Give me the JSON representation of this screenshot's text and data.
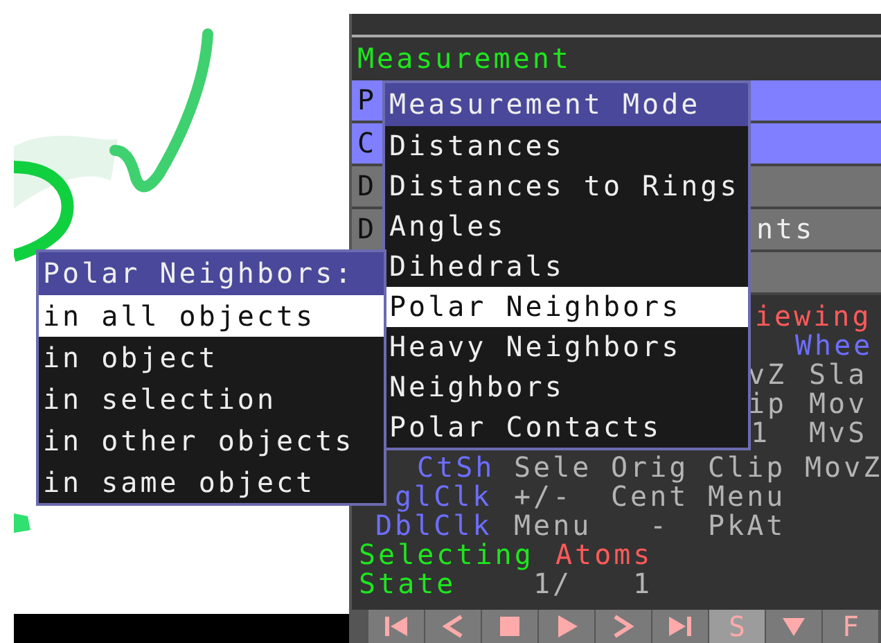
{
  "panel": {
    "title": "Measurement",
    "buttons": [
      {
        "label": "P",
        "color": "#7f7fff"
      },
      {
        "label": "C",
        "color": "#7f7fff"
      },
      {
        "label": "D",
        "color": "#737373"
      },
      {
        "label": "D",
        "tail": "nts",
        "color": "#737373"
      },
      {
        "color": "#737373"
      }
    ],
    "mouse_rows": [
      [
        {
          "text": "iewing",
          "kind": "mode"
        }
      ],
      [
        {
          "text": "Whee",
          "kind": "button"
        }
      ],
      [
        {
          "text": "vZ",
          "kind": "action"
        },
        {
          "text": "Sla",
          "kind": "action"
        }
      ],
      [
        {
          "text": "ip",
          "kind": "action"
        },
        {
          "text": "Mov",
          "kind": "action"
        }
      ],
      [
        {
          "text": "1",
          "kind": "action"
        },
        {
          "text": "MvS",
          "kind": "action"
        }
      ],
      [
        {
          "text": "CtSh",
          "kind": "button"
        },
        {
          "text": "Sele",
          "kind": "action"
        },
        {
          "text": "Orig",
          "kind": "action"
        },
        {
          "text": "Clip",
          "kind": "action"
        },
        {
          "text": "MovZ",
          "kind": "action"
        }
      ],
      [
        {
          "text": "glClk",
          "kind": "button"
        },
        {
          "text": "+/-",
          "kind": "action"
        },
        {
          "text": "Cent",
          "kind": "action"
        },
        {
          "text": "Menu",
          "kind": "action"
        }
      ],
      [
        {
          "text": "DblClk",
          "kind": "button"
        },
        {
          "text": "Menu",
          "kind": "action"
        },
        {
          "text": "-",
          "kind": "action"
        },
        {
          "text": "PkAt",
          "kind": "action"
        }
      ],
      [
        {
          "text": "Selecting",
          "kind": "label"
        },
        {
          "text": "Atoms",
          "kind": "mode"
        }
      ],
      [
        {
          "text": "State",
          "kind": "label"
        },
        {
          "text": "1/",
          "kind": "action"
        },
        {
          "text": "1",
          "kind": "action"
        }
      ]
    ],
    "player_buttons": [
      {
        "kind": "first",
        "on": false
      },
      {
        "kind": "prev",
        "on": false
      },
      {
        "kind": "stop",
        "on": false
      },
      {
        "kind": "play",
        "on": false
      },
      {
        "kind": "next",
        "on": false
      },
      {
        "kind": "last",
        "on": false
      },
      {
        "kind": "text",
        "label": "S",
        "on": true
      },
      {
        "kind": "down",
        "on": false
      },
      {
        "kind": "text",
        "label": "F",
        "on": false
      }
    ]
  },
  "menu": {
    "title": "Measurement Mode",
    "items": [
      {
        "label": "Distances",
        "selected": false
      },
      {
        "label": "Distances to Rings",
        "selected": false
      },
      {
        "label": "Angles",
        "selected": false
      },
      {
        "label": "Dihedrals",
        "selected": false
      },
      {
        "label": "Polar Neighbors",
        "selected": true
      },
      {
        "label": "Heavy Neighbors",
        "selected": false
      },
      {
        "label": "Neighbors",
        "selected": false
      },
      {
        "label": "Polar Contacts",
        "selected": false
      }
    ]
  },
  "submenu": {
    "title": "Polar Neighbors:",
    "items": [
      {
        "label": "in all objects",
        "selected": true
      },
      {
        "label": "in object",
        "selected": false
      },
      {
        "label": "in selection",
        "selected": false
      },
      {
        "label": "in other objects",
        "selected": false
      },
      {
        "label": "in same object",
        "selected": false
      }
    ]
  }
}
